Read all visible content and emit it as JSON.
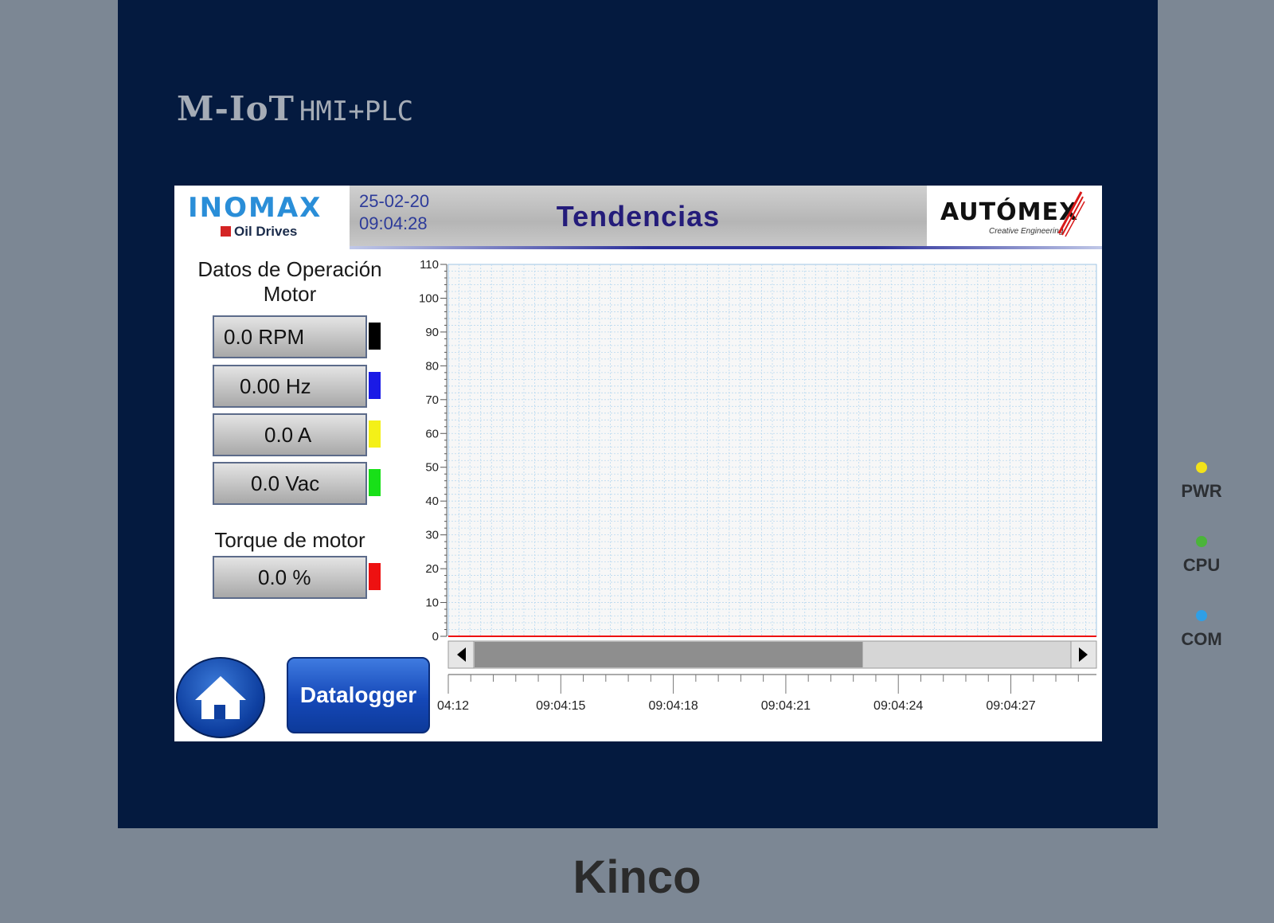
{
  "device": {
    "brand_top_big": "M-IoT",
    "brand_top_small": "HMI+PLC",
    "maker": "Kinco",
    "leds": [
      {
        "label": "PWR",
        "color": "#f2e21a"
      },
      {
        "label": "CPU",
        "color": "#4bb43a"
      },
      {
        "label": "COM",
        "color": "#2f9fe6"
      }
    ]
  },
  "header": {
    "logo_left": "INOMAX",
    "logo_left_sub": "Oil Drives",
    "date": "25-02-20",
    "time": "09:04:28",
    "title": "Tendencias",
    "logo_right": "AUTÓMEX",
    "logo_right_sub": "Creative Engineering"
  },
  "panel": {
    "title_line1": "Datos de Operación",
    "title_line2": "Motor",
    "readings": [
      {
        "value": "0.0 RPM",
        "color": "#000000"
      },
      {
        "value": "0.00 Hz",
        "color": "#1a1ae6"
      },
      {
        "value": "0.0 A",
        "color": "#f4f018"
      },
      {
        "value": "0.0 Vac",
        "color": "#18e018"
      }
    ],
    "torque_title": "Torque de motor",
    "torque": {
      "value": "0.0 %",
      "color": "#ee1111"
    }
  },
  "buttons": {
    "home_icon": "home-icon",
    "datalogger": "Datalogger"
  },
  "chart_data": {
    "type": "line",
    "ylim": [
      0,
      110
    ],
    "yticks": [
      0,
      10,
      20,
      30,
      40,
      50,
      60,
      70,
      80,
      90,
      100,
      110
    ],
    "xticks": [
      "04:12",
      "09:04:15",
      "09:04:18",
      "09:04:21",
      "09:04:24",
      "09:04:27"
    ],
    "grid": true,
    "series": [
      {
        "color": "#000000",
        "values": [
          0,
          0,
          0,
          0,
          0,
          0
        ]
      },
      {
        "color": "#1a1ae6",
        "values": [
          0,
          0,
          0,
          0,
          0,
          0
        ]
      },
      {
        "color": "#f4f018",
        "values": [
          0,
          0,
          0,
          0,
          0,
          0
        ]
      },
      {
        "color": "#18e018",
        "values": [
          0,
          0,
          0,
          0,
          0,
          0
        ]
      },
      {
        "color": "#ee1111",
        "values": [
          0,
          0,
          0,
          0,
          0,
          0
        ]
      }
    ],
    "scroll_position": 0.65
  }
}
